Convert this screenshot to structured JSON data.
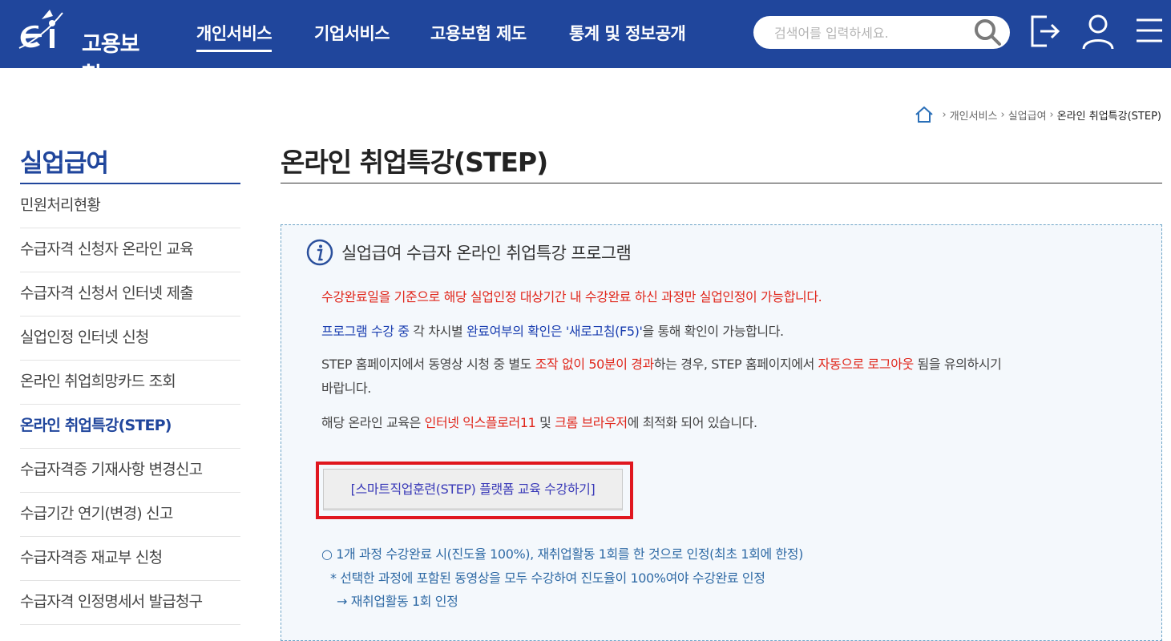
{
  "header": {
    "logo_text": "고용보험",
    "nav": [
      "개인서비스",
      "기업서비스",
      "고용보험 제도",
      "통계 및 정보공개"
    ],
    "search_placeholder": "검색어를 입력하세요.",
    "colors": {
      "brand": "#20469c",
      "accent_red": "#e0261b",
      "link_blue": "#1a3eb0"
    }
  },
  "breadcrumb": [
    "개인서비스",
    "실업급여",
    "온라인 취업특강(STEP)"
  ],
  "sidebar": {
    "title": "실업급여",
    "items": [
      "민원처리현황",
      "수급자격 신청자 온라인 교육",
      "수급자격 신청서 인터넷 제출",
      "실업인정 인터넷 신청",
      "온라인 취업희망카드 조회",
      "온라인 취업특강(STEP)",
      "수급자격증 기재사항 변경신고",
      "수급기간 연기(변경) 신고",
      "수급자격증 재교부 신청",
      "수급자격 인정명세서 발급청구"
    ]
  },
  "main": {
    "title": "온라인 취업특강(STEP)",
    "info_heading": "실업급여 수급자 온라인 취업특강 프로그램",
    "line1": "수강완료일을 기준으로 해당 실업인정 대상기간 내 수강완료 하신 과정만 실업인정이 가능합니다.",
    "line2": {
      "a": "프로그램 수강 중",
      "b": " 각 차시별 ",
      "c": "완료여부의 확인은 '새로고침(F5)'",
      "d": "을 통해 확인이 가능합니다."
    },
    "line3": {
      "a": "STEP 홈페이지에서 동영상 시청 중 별도 ",
      "b": "조작 없이 50분이 경과",
      "c": "하는 경우, STEP 홈페이지에서 ",
      "d": "자동으로 로그아웃",
      "e": " 됨을 유의하시기",
      "f": "바랍니다."
    },
    "line4": {
      "a": "해당 온라인 교육은 ",
      "b": "인터넷 익스플로러11",
      "c": " 및 ",
      "d": "크롬 브라우저",
      "e": "에 최적화 되어 있습니다."
    },
    "cta_label": "[스마트직업훈련(STEP) 플랫폼 교육 수강하기]",
    "notes": [
      "○ 1개 과정 수강완료 시(진도율 100%), 재취업활동 1회를 한 것으로 인정(최초 1회에 한정)",
      "* 선택한 과정에 포함된 동영상을 모두 수강하여 진도율이 100%여야 수강완료 인정",
      "→ 재취업활동 1회 인정"
    ]
  }
}
